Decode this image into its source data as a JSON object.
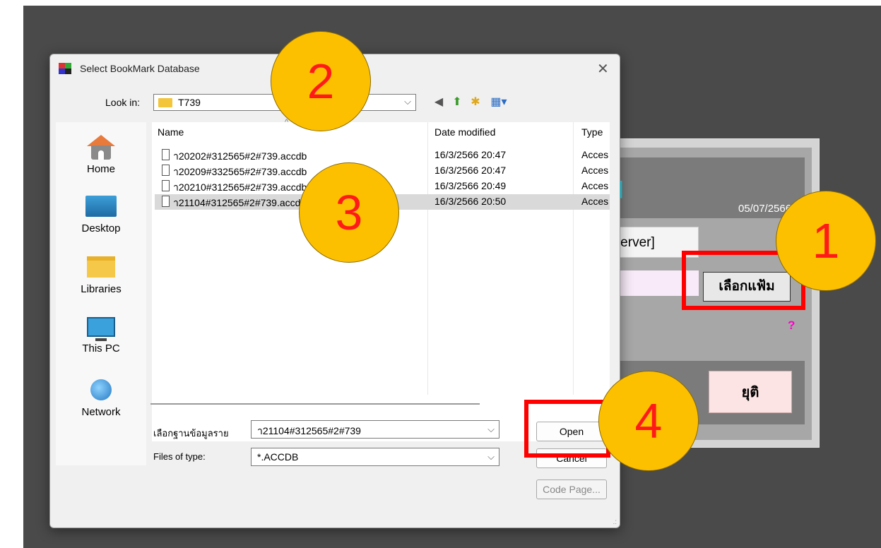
{
  "background_app": {
    "date": "05/07/2566",
    "server_label": "l Server]",
    "bracket": "]",
    "choose_file_button": "เลือกแฟ้ม",
    "help_mark": "?",
    "quit_button": "ยุติ"
  },
  "dialog": {
    "title": "Select BookMark Database",
    "look_in_label": "Look in:",
    "look_in_value": "T739",
    "places": [
      "Home",
      "Desktop",
      "Libraries",
      "This PC",
      "Network"
    ],
    "columns": {
      "name": "Name",
      "date": "Date modified",
      "type": "Type"
    },
    "files": [
      {
        "name": "า20202#312565#2#739.accdb",
        "date": "16/3/2566 20:47",
        "type": "Acces"
      },
      {
        "name": "า20209#332565#2#739.accdb",
        "date": "16/3/2566 20:47",
        "type": "Acces"
      },
      {
        "name": "า20210#312565#2#739.accdb",
        "date": "16/3/2566 20:49",
        "type": "Acces"
      },
      {
        "name": "า21104#312565#2#739.accdb",
        "date": "16/3/2566 20:50",
        "type": "Acces"
      }
    ],
    "file_name_label": "เลือกฐานข้อมูลราย",
    "file_name_value": "า21104#312565#2#739",
    "file_type_label": "Files of type:",
    "file_type_value": "*.ACCDB",
    "open_button": "Open",
    "cancel_button": "Cancel",
    "codepage_button": "Code Page..."
  },
  "annotations": {
    "step1": "1",
    "step2": "2",
    "step3": "3",
    "step4": "4"
  }
}
